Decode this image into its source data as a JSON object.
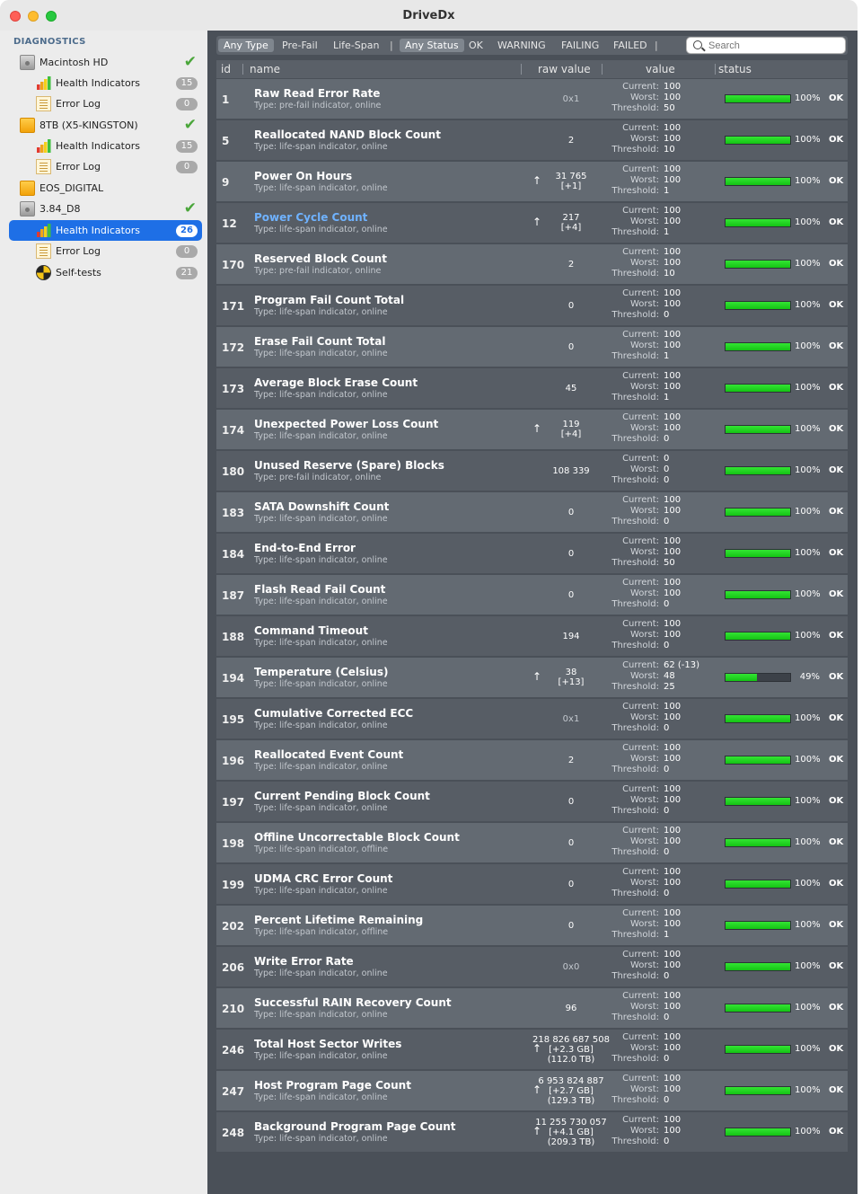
{
  "window": {
    "title": "DriveDx"
  },
  "sidebar": {
    "header": "DIAGNOSTICS",
    "items": [
      {
        "label": "Macintosh HD",
        "icon": "internal-disk-icon",
        "level": 0,
        "check": true
      },
      {
        "label": "Health Indicators",
        "icon": "health-bars-icon",
        "level": 1,
        "badge": "15"
      },
      {
        "label": "Error Log",
        "icon": "error-log-icon",
        "level": 1,
        "badge": "0"
      },
      {
        "label": "8TB (X5-KINGSTON)",
        "icon": "external-disk-icon",
        "level": 0,
        "check": true
      },
      {
        "label": "Health Indicators",
        "icon": "health-bars-icon",
        "level": 1,
        "badge": "15"
      },
      {
        "label": "Error Log",
        "icon": "error-log-icon",
        "level": 1,
        "badge": "0"
      },
      {
        "label": "EOS_DIGITAL",
        "icon": "external-disk-icon",
        "level": 0
      },
      {
        "label": "3.84_D8",
        "icon": "internal-disk-icon",
        "level": 0,
        "check": true
      },
      {
        "label": "Health Indicators",
        "icon": "health-bars-icon",
        "level": 1,
        "badge": "26",
        "selected": true
      },
      {
        "label": "Error Log",
        "icon": "error-log-icon",
        "level": 1,
        "badge": "0"
      },
      {
        "label": "Self-tests",
        "icon": "self-test-icon",
        "level": 1,
        "badge": "21"
      }
    ]
  },
  "toolbar": {
    "filters": [
      "Any Type",
      "Pre-Fail",
      "Life-Span",
      "Any Status",
      "OK",
      "WARNING",
      "FAILING",
      "FAILED"
    ],
    "search_placeholder": "Search"
  },
  "columns": {
    "id": "id",
    "name": "name",
    "raw": "raw value",
    "value": "value",
    "status": "status"
  },
  "labels": {
    "current": "Current:",
    "worst": "Worst:",
    "threshold": "Threshold:"
  },
  "colors": {
    "ok_bar": "#1ed21e",
    "selection": "#1e6fe6",
    "link": "#6fb2ff"
  },
  "rows": [
    {
      "id": "1",
      "name": "Raw Read Error Rate",
      "type": "Type: pre-fail indicator, online",
      "raw": "0x1",
      "raw_dim": true,
      "current": "100",
      "worst": "100",
      "threshold": "50",
      "pct": "100%",
      "level": 1.0,
      "status": "OK"
    },
    {
      "id": "5",
      "name": "Reallocated NAND Block Count",
      "type": "Type: life-span indicator, online",
      "raw": "2",
      "current": "100",
      "worst": "100",
      "threshold": "10",
      "pct": "100%",
      "level": 1.0,
      "status": "OK"
    },
    {
      "id": "9",
      "name": "Power On Hours",
      "type": "Type: life-span indicator, online",
      "raw": "31 765\n[+1]",
      "arrow": true,
      "current": "100",
      "worst": "100",
      "threshold": "1",
      "pct": "100%",
      "level": 1.0,
      "status": "OK"
    },
    {
      "id": "12",
      "name": "Power Cycle Count",
      "type": "Type: life-span indicator, online",
      "raw": "217\n[+4]",
      "arrow": true,
      "link": true,
      "current": "100",
      "worst": "100",
      "threshold": "1",
      "pct": "100%",
      "level": 1.0,
      "status": "OK"
    },
    {
      "id": "170",
      "name": "Reserved Block Count",
      "type": "Type: pre-fail indicator, online",
      "raw": "2",
      "current": "100",
      "worst": "100",
      "threshold": "10",
      "pct": "100%",
      "level": 1.0,
      "status": "OK"
    },
    {
      "id": "171",
      "name": "Program Fail Count Total",
      "type": "Type: life-span indicator, online",
      "raw": "0",
      "current": "100",
      "worst": "100",
      "threshold": "0",
      "pct": "100%",
      "level": 1.0,
      "status": "OK"
    },
    {
      "id": "172",
      "name": "Erase Fail Count Total",
      "type": "Type: life-span indicator, online",
      "raw": "0",
      "current": "100",
      "worst": "100",
      "threshold": "1",
      "pct": "100%",
      "level": 1.0,
      "status": "OK"
    },
    {
      "id": "173",
      "name": "Average Block Erase Count",
      "type": "Type: life-span indicator, online",
      "raw": "45",
      "current": "100",
      "worst": "100",
      "threshold": "1",
      "pct": "100%",
      "level": 1.0,
      "status": "OK"
    },
    {
      "id": "174",
      "name": "Unexpected Power Loss Count",
      "type": "Type: life-span indicator, online",
      "raw": "119\n[+4]",
      "arrow": true,
      "current": "100",
      "worst": "100",
      "threshold": "0",
      "pct": "100%",
      "level": 1.0,
      "status": "OK"
    },
    {
      "id": "180",
      "name": "Unused Reserve (Spare) Blocks",
      "type": "Type: pre-fail indicator, online",
      "raw": "108 339",
      "current": "0",
      "worst": "0",
      "threshold": "0",
      "pct": "100%",
      "level": 1.0,
      "status": "OK"
    },
    {
      "id": "183",
      "name": "SATA Downshift Count",
      "type": "Type: life-span indicator, online",
      "raw": "0",
      "current": "100",
      "worst": "100",
      "threshold": "0",
      "pct": "100%",
      "level": 1.0,
      "status": "OK"
    },
    {
      "id": "184",
      "name": "End-to-End Error",
      "type": "Type: life-span indicator, online",
      "raw": "0",
      "current": "100",
      "worst": "100",
      "threshold": "50",
      "pct": "100%",
      "level": 1.0,
      "status": "OK"
    },
    {
      "id": "187",
      "name": "Flash Read Fail Count",
      "type": "Type: life-span indicator, online",
      "raw": "0",
      "current": "100",
      "worst": "100",
      "threshold": "0",
      "pct": "100%",
      "level": 1.0,
      "status": "OK"
    },
    {
      "id": "188",
      "name": "Command Timeout",
      "type": "Type: life-span indicator, online",
      "raw": "194",
      "current": "100",
      "worst": "100",
      "threshold": "0",
      "pct": "100%",
      "level": 1.0,
      "status": "OK"
    },
    {
      "id": "194",
      "name": "Temperature (Celsius)",
      "type": "Type: life-span indicator, online",
      "raw": "38\n[+13]",
      "arrow": true,
      "current": "62 (-13)",
      "worst": "48",
      "threshold": "25",
      "pct": "49%",
      "level": 0.49,
      "status": "OK"
    },
    {
      "id": "195",
      "name": "Cumulative Corrected ECC",
      "type": "Type: life-span indicator, online",
      "raw": "0x1",
      "raw_dim": true,
      "current": "100",
      "worst": "100",
      "threshold": "0",
      "pct": "100%",
      "level": 1.0,
      "status": "OK"
    },
    {
      "id": "196",
      "name": "Reallocated Event Count",
      "type": "Type: life-span indicator, online",
      "raw": "2",
      "current": "100",
      "worst": "100",
      "threshold": "0",
      "pct": "100%",
      "level": 1.0,
      "status": "OK"
    },
    {
      "id": "197",
      "name": "Current Pending Block Count",
      "type": "Type: life-span indicator, online",
      "raw": "0",
      "current": "100",
      "worst": "100",
      "threshold": "0",
      "pct": "100%",
      "level": 1.0,
      "status": "OK"
    },
    {
      "id": "198",
      "name": "Offline Uncorrectable Block Count",
      "type": "Type: life-span indicator, offline",
      "raw": "0",
      "current": "100",
      "worst": "100",
      "threshold": "0",
      "pct": "100%",
      "level": 1.0,
      "status": "OK"
    },
    {
      "id": "199",
      "name": "UDMA CRC Error Count",
      "type": "Type: life-span indicator, online",
      "raw": "0",
      "current": "100",
      "worst": "100",
      "threshold": "0",
      "pct": "100%",
      "level": 1.0,
      "status": "OK"
    },
    {
      "id": "202",
      "name": "Percent Lifetime Remaining",
      "type": "Type: life-span indicator, offline",
      "raw": "0",
      "current": "100",
      "worst": "100",
      "threshold": "1",
      "pct": "100%",
      "level": 1.0,
      "status": "OK"
    },
    {
      "id": "206",
      "name": "Write Error Rate",
      "type": "Type: life-span indicator, online",
      "raw": "0x0",
      "raw_dim": true,
      "current": "100",
      "worst": "100",
      "threshold": "0",
      "pct": "100%",
      "level": 1.0,
      "status": "OK"
    },
    {
      "id": "210",
      "name": "Successful RAIN Recovery Count",
      "type": "Type: life-span indicator, online",
      "raw": "96",
      "current": "100",
      "worst": "100",
      "threshold": "0",
      "pct": "100%",
      "level": 1.0,
      "status": "OK"
    },
    {
      "id": "246",
      "name": "Total Host Sector Writes",
      "type": "Type: life-span indicator, online",
      "raw": "218 826 687 508\n[+2.3 GB]\n(112.0 TB)",
      "arrow": true,
      "current": "100",
      "worst": "100",
      "threshold": "0",
      "pct": "100%",
      "level": 1.0,
      "status": "OK"
    },
    {
      "id": "247",
      "name": "Host Program Page Count",
      "type": "Type: life-span indicator, online",
      "raw": "6 953 824 887\n[+2.7 GB]\n(129.3 TB)",
      "arrow": true,
      "current": "100",
      "worst": "100",
      "threshold": "0",
      "pct": "100%",
      "level": 1.0,
      "status": "OK"
    },
    {
      "id": "248",
      "name": "Background Program Page Count",
      "type": "Type: life-span indicator, online",
      "raw": "11 255 730 057\n[+4.1 GB]\n(209.3 TB)",
      "arrow": true,
      "current": "100",
      "worst": "100",
      "threshold": "0",
      "pct": "100%",
      "level": 1.0,
      "status": "OK"
    }
  ]
}
